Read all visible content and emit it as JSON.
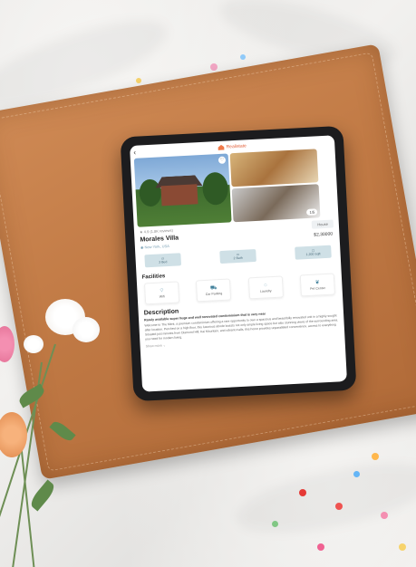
{
  "app": {
    "logo_text": "Realistate"
  },
  "gallery": {
    "photo_count": "1/5"
  },
  "listing": {
    "rating": "4.9 (1.8K reviews)",
    "title": "Morales Villa",
    "location": "New York, USA",
    "tag": "House",
    "price": "$2,30000"
  },
  "features": [
    {
      "label": "3 Bed"
    },
    {
      "label": "2 Bath"
    },
    {
      "label": "1,200 Sqft"
    }
  ],
  "facilities": {
    "heading": "Facilities",
    "items": [
      {
        "label": "Wifi",
        "icon": "wifi-icon"
      },
      {
        "label": "Car Parking",
        "icon": "car-icon"
      },
      {
        "label": "Laundry",
        "icon": "laundry-icon"
      },
      {
        "label": "Pet Center",
        "icon": "paw-icon"
      }
    ]
  },
  "description": {
    "heading": "Description",
    "lead": "Rarely available super huge and well renovated condominium that is very near",
    "body": "Welcome to The Merit, a premium condominium offering a rare opportunity to own a spacious and beautifully renovated unit in a highly sought after location. Perched on a high floor, this luxurious abode boasts not only ample living space but also stunning views of the surrounding area. Situated just minutes from Diamond Hill, Kai Mountain, and vibrant malls, this home provides unparalleled convenience, access to everything you need for modern living.",
    "more": "Show more"
  },
  "colors": {
    "accent": "#e2603a",
    "feature_bg": "#cfe0e6",
    "leather": "#c17a45"
  }
}
